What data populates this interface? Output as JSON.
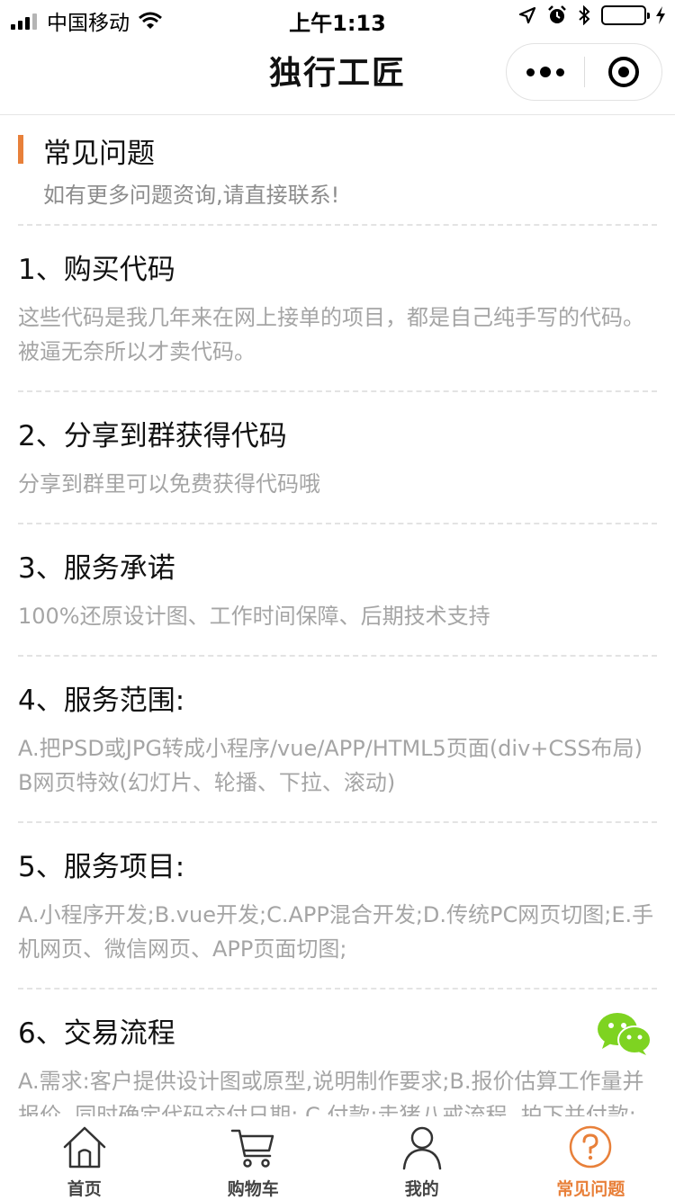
{
  "status_bar": {
    "carrier": "中国移动",
    "time": "上午1:13"
  },
  "nav": {
    "title": "独行工匠"
  },
  "header": {
    "title": "常见问题",
    "subtitle": "如有更多问题资询,请直接联系!"
  },
  "faq": [
    {
      "question": "1、购买代码",
      "answer": "这些代码是我几年来在网上接单的项目，都是自己纯手写的代码。被逼无奈所以才卖代码。"
    },
    {
      "question": "2、分享到群获得代码",
      "answer": "分享到群里可以免费获得代码哦"
    },
    {
      "question": "3、服务承诺",
      "answer": "100%还原设计图、工作时间保障、后期技术支持"
    },
    {
      "question": "4、服务范围:",
      "answer": "A.把PSD或JPG转成小程序/vue/APP/HTML5页面(div+CSS布局)B网页特效(幻灯片、轮播、下拉、滚动)"
    },
    {
      "question": "5、服务项目:",
      "answer": "A.小程序开发;B.vue开发;C.APP混合开发;D.传统PC网页切图;E.手机网页、微信网页、APP页面切图;"
    },
    {
      "question": "6、交易流程",
      "answer": "A.需求:客户提供设计图或原型,说明制作要求;B.报价估算工作量并报价, 同时确定代码交付日期; C.付款:走猪八戒流程, 拍下并付款; D.验收: 交付代码并发货,验收合格后确认收货并好评"
    }
  ],
  "tabs": [
    {
      "label": "首页",
      "icon": "home-icon"
    },
    {
      "label": "购物车",
      "icon": "cart-icon"
    },
    {
      "label": "我的",
      "icon": "user-icon"
    },
    {
      "label": "常见问题",
      "icon": "question-icon"
    }
  ],
  "colors": {
    "accent": "#e8803a",
    "question_text": "#111111",
    "answer_text": "#a5a5a5",
    "wechat_green": "#7ed321"
  }
}
